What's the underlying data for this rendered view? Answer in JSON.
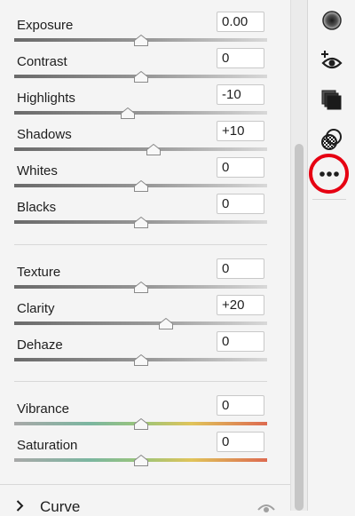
{
  "basic_sliders": [
    {
      "label": "Exposure",
      "value": "0.00",
      "position": 0.5
    },
    {
      "label": "Contrast",
      "value": "0",
      "position": 0.5
    },
    {
      "label": "Highlights",
      "value": "-10",
      "position": 0.45
    },
    {
      "label": "Shadows",
      "value": "+10",
      "position": 0.55
    },
    {
      "label": "Whites",
      "value": "0",
      "position": 0.5
    },
    {
      "label": "Blacks",
      "value": "0",
      "position": 0.5
    }
  ],
  "presence_sliders": [
    {
      "label": "Texture",
      "value": "0",
      "position": 0.5
    },
    {
      "label": "Clarity",
      "value": "+20",
      "position": 0.6
    },
    {
      "label": "Dehaze",
      "value": "0",
      "position": 0.5
    }
  ],
  "color_sliders": [
    {
      "label": "Vibrance",
      "value": "0",
      "position": 0.5
    },
    {
      "label": "Saturation",
      "value": "0",
      "position": 0.5
    }
  ],
  "curve_section": {
    "label": "Curve"
  },
  "right_toolbar": {
    "icons": [
      "masking-icon",
      "red-eye-icon",
      "presets-icon",
      "mixer-icon",
      "more-options-icon"
    ],
    "highlight_color": "#e60012"
  }
}
